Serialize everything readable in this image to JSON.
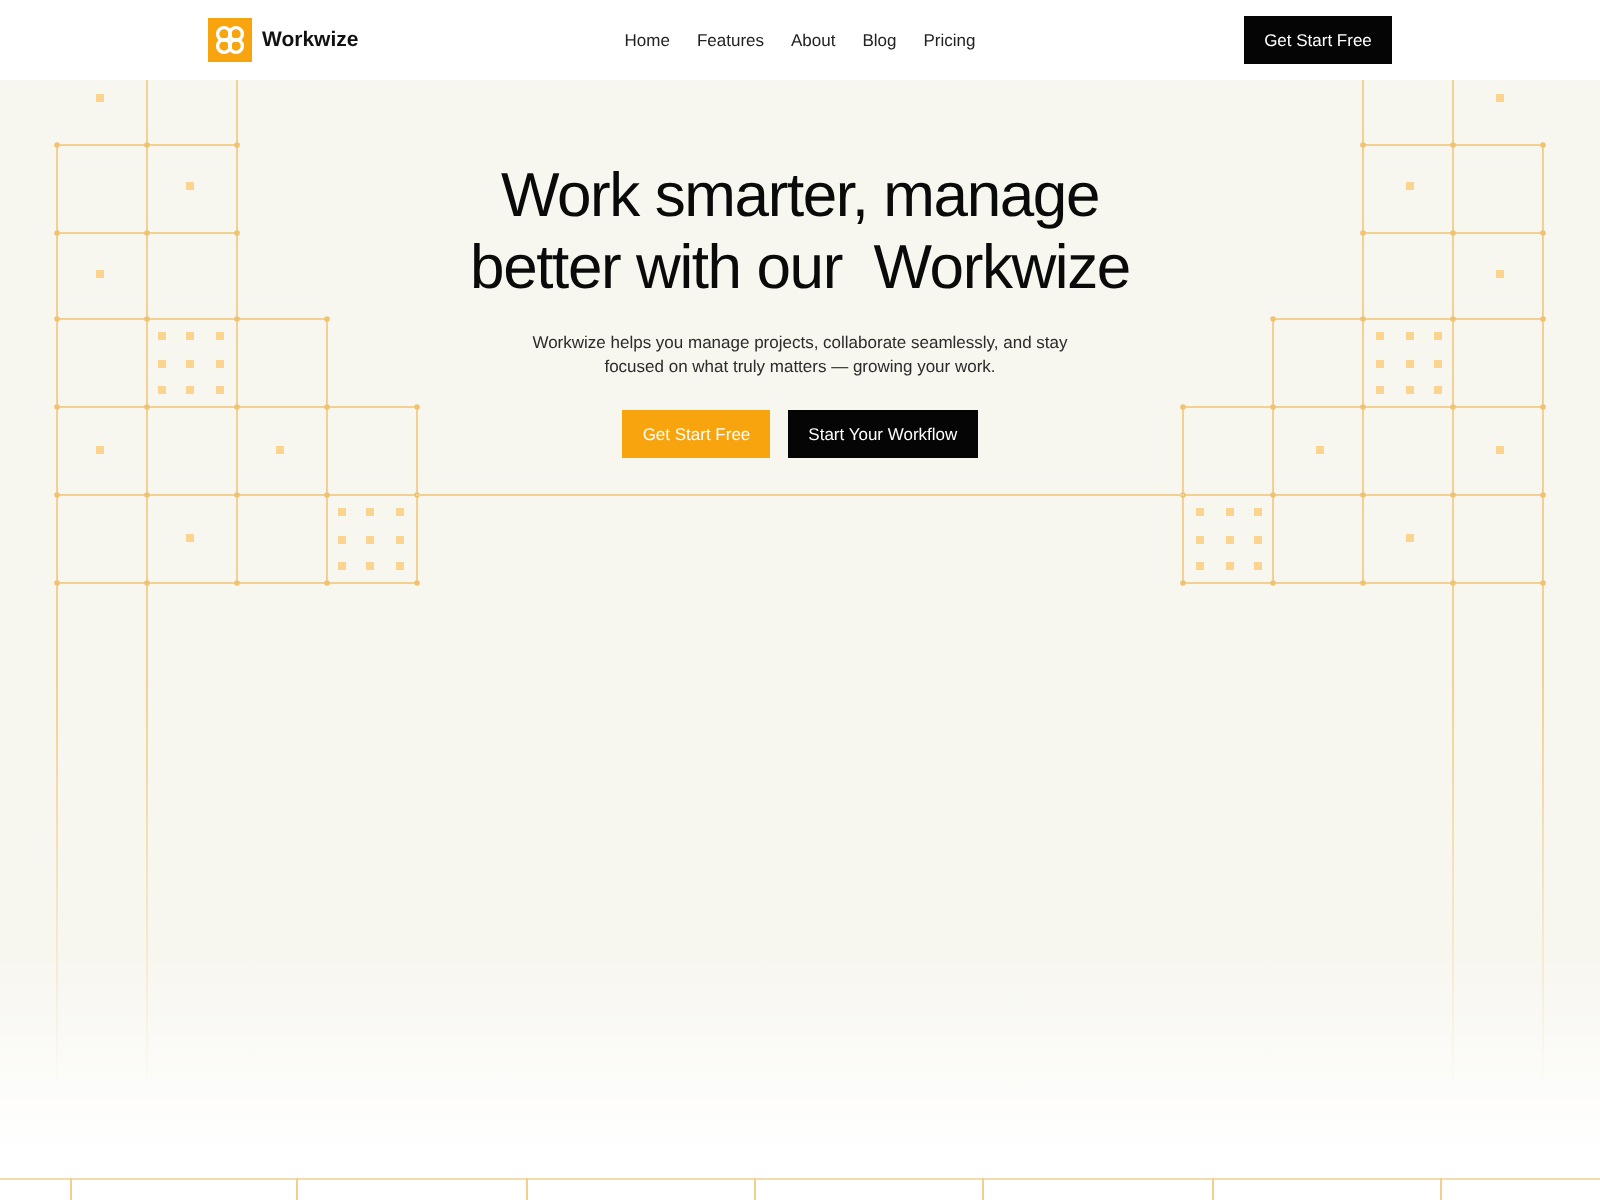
{
  "header": {
    "brand": "Workwize",
    "nav": [
      "Home",
      "Features",
      "About",
      "Blog",
      "Pricing"
    ],
    "cta": "Get Start Free"
  },
  "hero": {
    "title": "Work smarter, manage better with our  Workwize",
    "subtitle": "Workwize helps you manage projects, collaborate seamlessly, and stay focused on what truly matters — growing your work.",
    "buttons": [
      {
        "label": "Get Start Free",
        "kind": "primary"
      },
      {
        "label": "Start Your Workflow",
        "kind": "dark"
      }
    ]
  }
}
